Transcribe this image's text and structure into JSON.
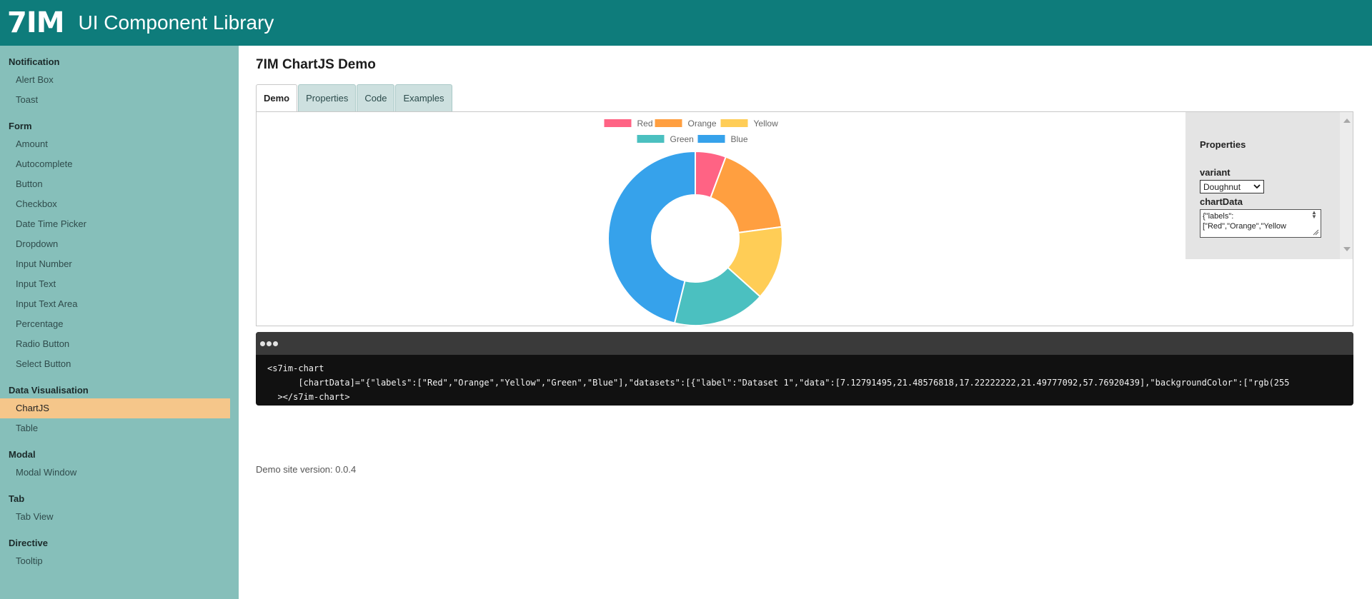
{
  "header": {
    "logo": "7IM",
    "title": "UI Component Library"
  },
  "sidebar": {
    "sections": [
      {
        "title": "Notification",
        "items": [
          "Alert Box",
          "Toast"
        ]
      },
      {
        "title": "Form",
        "items": [
          "Amount",
          "Autocomplete",
          "Button",
          "Checkbox",
          "Date Time Picker",
          "Dropdown",
          "Input Number",
          "Input Text",
          "Input Text Area",
          "Percentage",
          "Radio Button",
          "Select Button"
        ]
      },
      {
        "title": "Data Visualisation",
        "items": [
          "ChartJS",
          "Table"
        ]
      },
      {
        "title": "Modal",
        "items": [
          "Modal Window"
        ]
      },
      {
        "title": "Tab",
        "items": [
          "Tab View"
        ]
      },
      {
        "title": "Directive",
        "items": [
          "Tooltip"
        ]
      }
    ],
    "active_item": "ChartJS"
  },
  "main": {
    "title": "7IM ChartJS Demo",
    "tabs": [
      "Demo",
      "Properties",
      "Code",
      "Examples"
    ],
    "active_tab": "Demo",
    "properties_panel": {
      "title": "Properties",
      "variant_label": "variant",
      "variant_value": "Doughnut",
      "chart_data_label": "chartData",
      "chart_data_value": "{\"labels\":\n[\"Red\",\"Orange\",\"Yellow"
    },
    "code": {
      "line1": "<s7im-chart",
      "line2": "      [chartData]=\"{\"labels\":[\"Red\",\"Orange\",\"Yellow\",\"Green\",\"Blue\"],\"datasets\":[{\"label\":\"Dataset 1\",\"data\":[7.12791495,21.48576818,17.22222222,21.49777092,57.76920439],\"backgroundColor\":[\"rgb(255",
      "line3": "  ></s7im-chart>"
    },
    "version": "Demo site version: 0.0.4"
  },
  "colors": {
    "topbar": "#0e7c7b",
    "sidebar": "#86bfba",
    "active_item": "#f5c68a"
  },
  "chart_data": {
    "type": "doughnut",
    "categories": [
      "Red",
      "Orange",
      "Yellow",
      "Green",
      "Blue"
    ],
    "series": [
      {
        "name": "Dataset 1",
        "values": [
          7.12791495,
          21.48576818,
          17.22222222,
          21.49777092,
          57.76920439
        ]
      }
    ],
    "colors": [
      "#ff6384",
      "#ff9f40",
      "#ffcd56",
      "#4bc0c0",
      "#36a2eb"
    ],
    "legend": "top"
  }
}
